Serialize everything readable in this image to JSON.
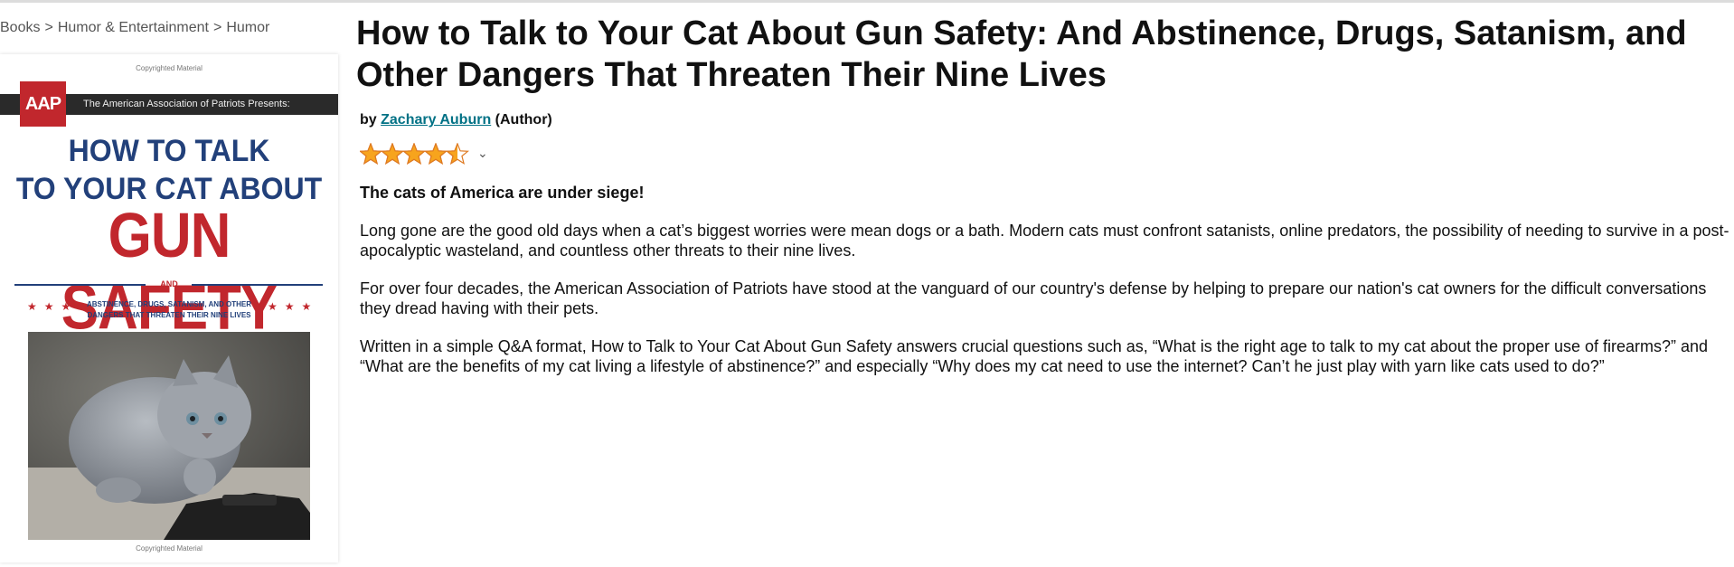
{
  "breadcrumb": {
    "items": [
      "Books",
      "Humor & Entertainment",
      "Humor"
    ],
    "separator": ">"
  },
  "cover": {
    "copyright_top": "Copyrighted Material",
    "logo_text": "AAP",
    "presents": "The American Association of Patriots Presents:",
    "title_line1": "HOW TO TALK",
    "title_line2": "TO YOUR CAT ABOUT",
    "title_line3": "GUN SAFETY",
    "and": "AND",
    "subtitle_line1": "ABSTINENCE, DRUGS, SATANISM, AND OTHER",
    "subtitle_line2": "DANGERS THAT THREATEN THEIR NINE LIVES",
    "copyright_bottom": "Copyrighted Material"
  },
  "product": {
    "title": "How to Talk to Your Cat About Gun Safety: And Abstinence, Drugs, Satanism, and Other Dangers That Threaten Their Nine Lives",
    "by_prefix": "by",
    "author": "Zachary Auburn",
    "author_role": "(Author)",
    "rating": 4.5,
    "rating_max": 5
  },
  "description": {
    "lead": "The cats of America are under siege!",
    "paragraphs": [
      "Long gone are the good old days when a cat’s biggest worries were mean dogs or a bath. Modern cats must confront satanists, online predators, the possibility of needing to survive in a post-apocalyptic wasteland, and countless other threats to their nine lives.",
      "For over four decades, the American Association of Patriots have stood at the vanguard of our country's defense by helping to prepare our nation's cat owners for the difficult conversations they dread having with their pets.",
      "Written in a simple Q&A format, How to Talk to Your Cat About Gun Safety answers crucial questions such as, “What is the right age to talk to my cat about the proper use of firearms?” and “What are the benefits of my cat living a lifestyle of abstinence?” and especially “Why does my cat need to use the internet? Can’t he just play with yarn like cats used to do?”"
    ]
  },
  "colors": {
    "link": "#007185",
    "star": "#f7a41d",
    "star_outline": "#de7921",
    "cover_blue": "#22407a",
    "cover_red": "#c1272d"
  },
  "icons": {
    "rating": "star-icon",
    "dropdown": "chevron-down-icon"
  }
}
